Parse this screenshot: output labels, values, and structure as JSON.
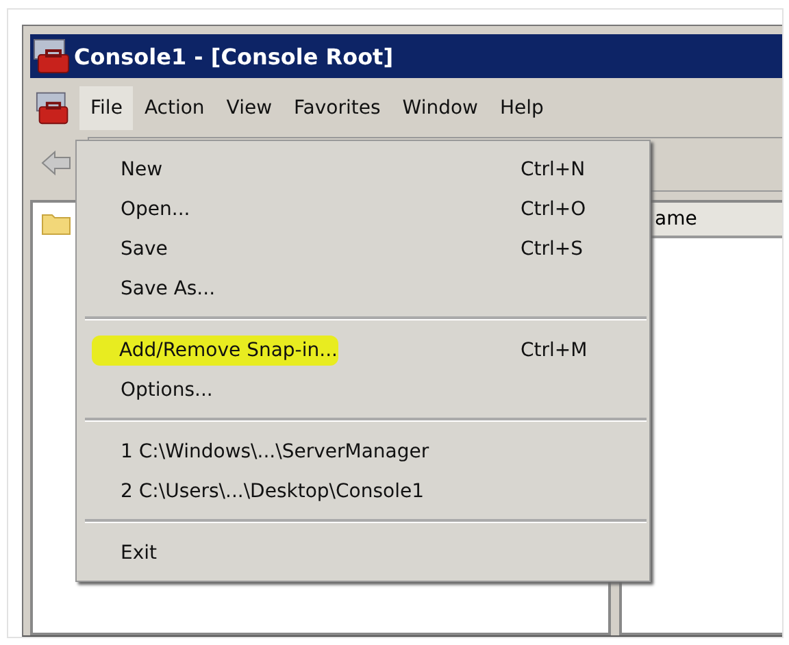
{
  "window": {
    "title": "Console1 - [Console Root]"
  },
  "menubar": [
    {
      "label": "File",
      "selected": true
    },
    {
      "label": "Action",
      "selected": false
    },
    {
      "label": "View",
      "selected": false
    },
    {
      "label": "Favorites",
      "selected": false
    },
    {
      "label": "Window",
      "selected": false
    },
    {
      "label": "Help",
      "selected": false
    }
  ],
  "file_menu": [
    {
      "kind": "item",
      "label": "New",
      "shortcut": "Ctrl+N",
      "highlighted": false
    },
    {
      "kind": "item",
      "label": "Open...",
      "shortcut": "Ctrl+O",
      "highlighted": false
    },
    {
      "kind": "item",
      "label": "Save",
      "shortcut": "Ctrl+S",
      "highlighted": false
    },
    {
      "kind": "item",
      "label": "Save As...",
      "highlighted": false
    },
    {
      "kind": "separator"
    },
    {
      "kind": "item",
      "label": "Add/Remove Snap-in...",
      "shortcut": "Ctrl+M",
      "highlighted": true
    },
    {
      "kind": "item",
      "label": "Options...",
      "highlighted": false
    },
    {
      "kind": "separator"
    },
    {
      "kind": "item",
      "label": "1 C:\\Windows\\...\\ServerManager",
      "highlighted": false
    },
    {
      "kind": "item",
      "label": "2 C:\\Users\\...\\Desktop\\Console1",
      "highlighted": false
    },
    {
      "kind": "separator"
    },
    {
      "kind": "item",
      "label": "Exit",
      "highlighted": false
    }
  ],
  "right_pane": {
    "column_header": "ame"
  }
}
